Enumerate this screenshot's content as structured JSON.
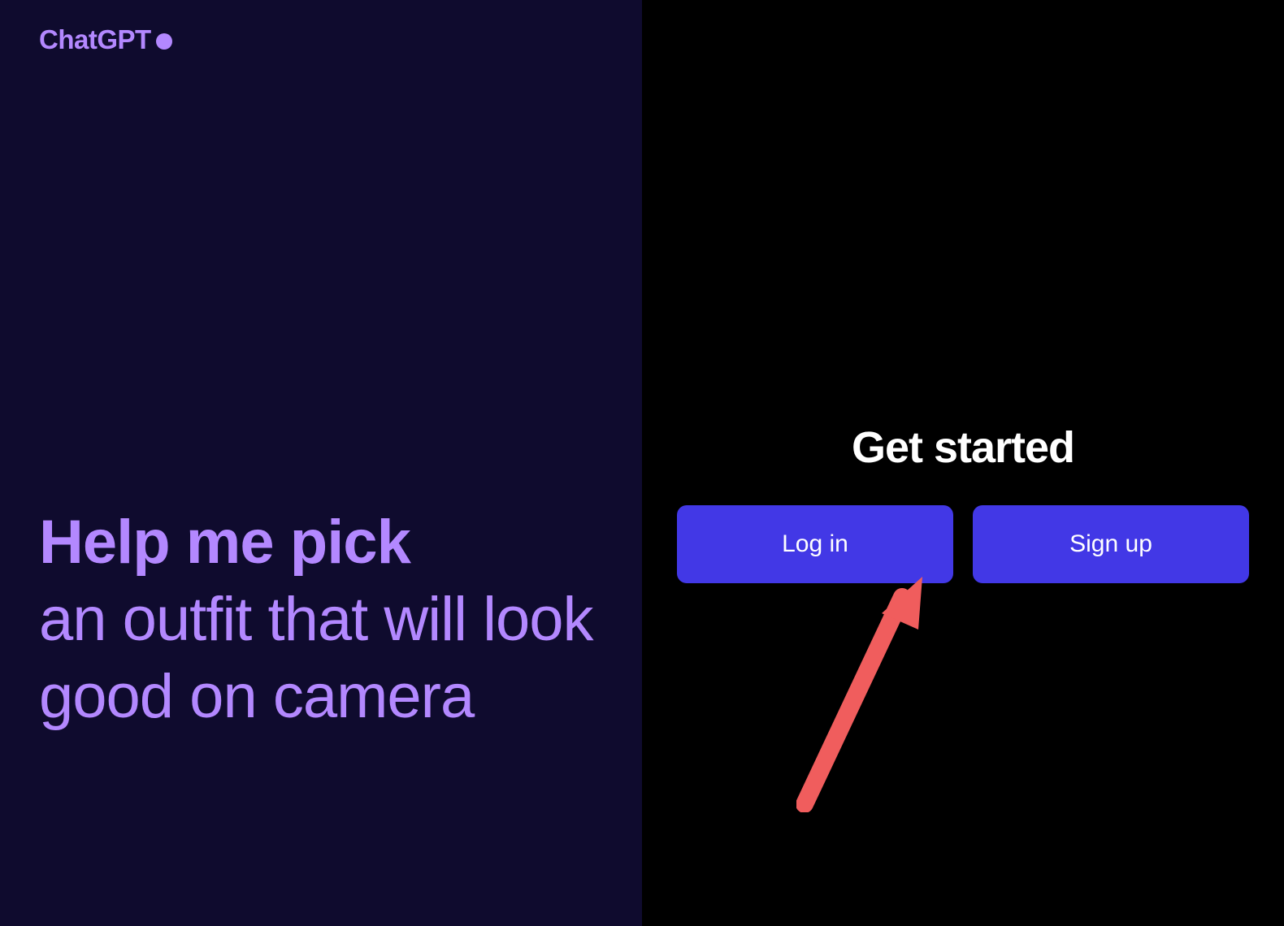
{
  "logo": {
    "text": "ChatGPT"
  },
  "prompt": {
    "bold": "Help me pick",
    "regular": "an outfit that will look good on camera"
  },
  "rightPanel": {
    "heading": "Get started",
    "loginLabel": "Log in",
    "signupLabel": "Sign up"
  },
  "colors": {
    "leftBackground": "#0f0b2e",
    "rightBackground": "#000000",
    "accentPurple": "#b388ff",
    "buttonBlue": "#4238e6",
    "annotationRed": "#f05d5d"
  }
}
